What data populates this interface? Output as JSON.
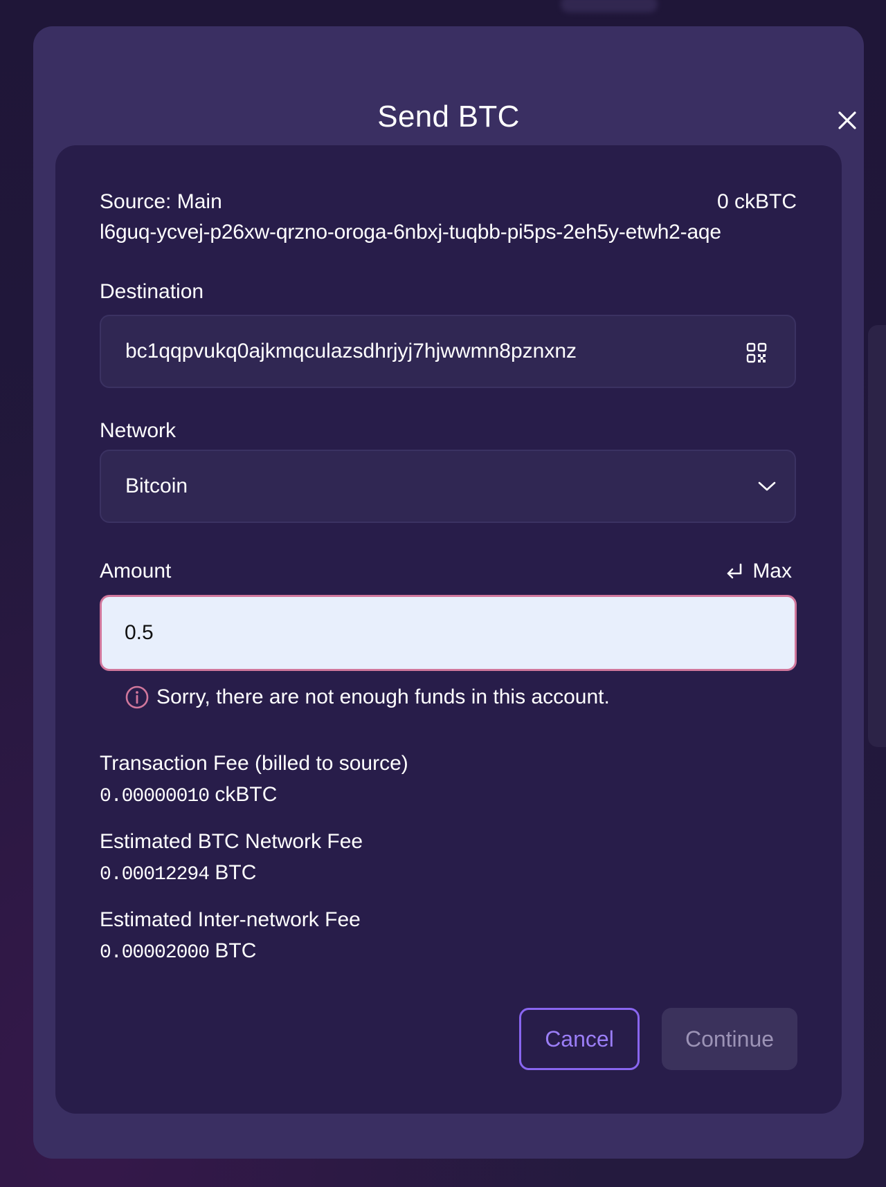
{
  "modal": {
    "title": "Send BTC",
    "close_icon": "close-icon"
  },
  "source": {
    "label": "Source: Main",
    "balance": "0 ckBTC",
    "address": "l6guq-ycvej-p26xw-qrzno-oroga-6nbxj-tuqbb-pi5ps-2eh5y-etwh2-aqe"
  },
  "destination": {
    "label": "Destination",
    "value": "bc1qqpvukq0ajkmqculazsdhrjyj7hjwwmn8pznxnz",
    "icon": "qr-code-icon"
  },
  "network": {
    "label": "Network",
    "selected": "Bitcoin",
    "icon": "chevron-down-icon"
  },
  "amount": {
    "label": "Amount",
    "max_label": "Max",
    "max_icon": "return-arrow-icon",
    "value": "0.5",
    "error": "Sorry, there are not enough funds in this account.",
    "error_icon": "info-icon"
  },
  "fees": {
    "transaction_label": "Transaction Fee (billed to source)",
    "transaction_amount": "0.00000010",
    "transaction_unit": "ckBTC",
    "network_label": "Estimated BTC Network Fee",
    "network_amount": "0.00012294",
    "network_unit": "BTC",
    "internetwork_label": "Estimated Inter-network Fee",
    "internetwork_amount": "0.00002000",
    "internetwork_unit": "BTC"
  },
  "actions": {
    "cancel_label": "Cancel",
    "continue_label": "Continue"
  },
  "colors": {
    "modal_bg": "#3a2f62",
    "card_bg": "#281d4a",
    "accent": "#8966f0",
    "error": "#d1779c",
    "input_bg": "#e8effc"
  }
}
